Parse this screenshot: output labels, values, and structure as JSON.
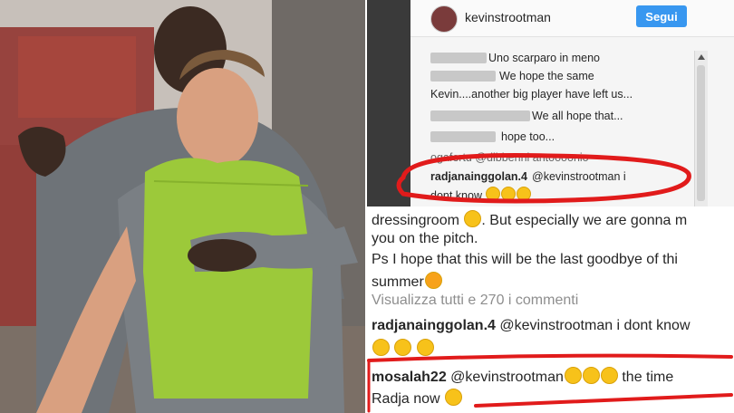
{
  "instagram_panel": {
    "username": "kevinstrootman",
    "follow_label": "Segui",
    "comments": [
      {
        "text": "Uno scarparo in meno"
      },
      {
        "text": "We hope the same"
      },
      {
        "text": "Kevin....another big player have left us..."
      },
      {
        "text": "We all hope that..."
      },
      {
        "text": "hope too..."
      },
      {
        "text": "ogafertu @dibbenni antoooonio"
      },
      {
        "user": "radjanainggolan.4",
        "text": "@kevinstrootman i",
        "text2": "dont know"
      }
    ]
  },
  "bottom_panel": {
    "line1": "dressingroom",
    "line1_rest": ". But especially we are gonna m",
    "line2": "you on the pitch.",
    "line3": "Ps I hope that this will be the last goodbye of thi",
    "line4": "summer",
    "view_all": "Visualizza tutti e 270 i commenti",
    "comment1_user": "radjanainggolan.4",
    "comment1_text": "@kevinstrootman i dont know",
    "comment2_user": "mosalah22",
    "comment2_text": "@kevinstrootman",
    "comment2_tail": "the time",
    "comment2_line2": "Radja now"
  },
  "colors": {
    "follow_button": "#3897f0",
    "red_marker": "#e11b1b",
    "bib_green": "#9cc93a"
  }
}
